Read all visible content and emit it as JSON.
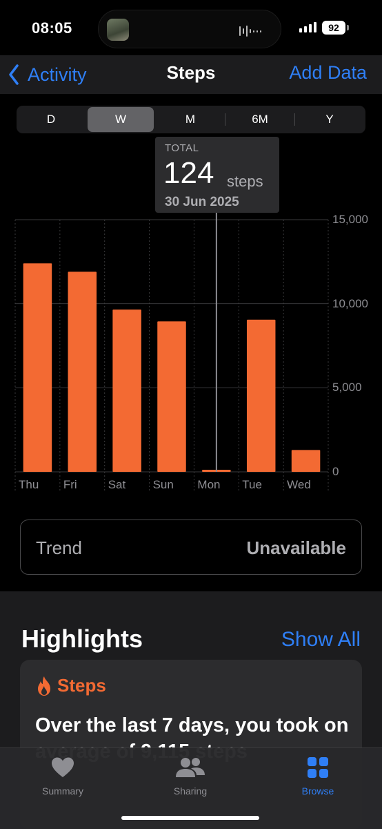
{
  "status_bar": {
    "time": "08:05",
    "battery": "92"
  },
  "nav": {
    "back_label": "Activity",
    "title": "Steps",
    "action_label": "Add Data"
  },
  "range_tabs": [
    {
      "label": "D",
      "selected": false
    },
    {
      "label": "W",
      "selected": true
    },
    {
      "label": "M",
      "selected": false
    },
    {
      "label": "6M",
      "selected": false
    },
    {
      "label": "Y",
      "selected": false
    }
  ],
  "tooltip": {
    "label": "TOTAL",
    "value": "124",
    "unit": "steps",
    "date": "30 Jun 2025"
  },
  "chart_data": {
    "type": "bar",
    "categories": [
      "Thu",
      "Fri",
      "Sat",
      "Sun",
      "Mon",
      "Tue",
      "Wed"
    ],
    "values": [
      12400,
      11900,
      9650,
      8950,
      124,
      9050,
      1300
    ],
    "y_ticks": [
      "15,000",
      "10,000",
      "5,000",
      "0"
    ],
    "ylim": [
      0,
      15000
    ],
    "bar_color": "#f36a33",
    "grid": true,
    "selected_category": "Mon"
  },
  "trend": {
    "label": "Trend",
    "value": "Unavailable"
  },
  "highlights": {
    "title": "Highlights",
    "show_all_label": "Show All",
    "card": {
      "metric": "Steps",
      "text": "Over the last 7 days, you took on average of 9,115 steps"
    }
  },
  "tab_bar": [
    {
      "label": "Summary",
      "icon": "heart-icon",
      "active": false
    },
    {
      "label": "Sharing",
      "icon": "people-icon",
      "active": false
    },
    {
      "label": "Browse",
      "icon": "grid-icon",
      "active": true
    }
  ],
  "colors": {
    "accent": "#2f7ff6",
    "steps": "#f36a33"
  }
}
